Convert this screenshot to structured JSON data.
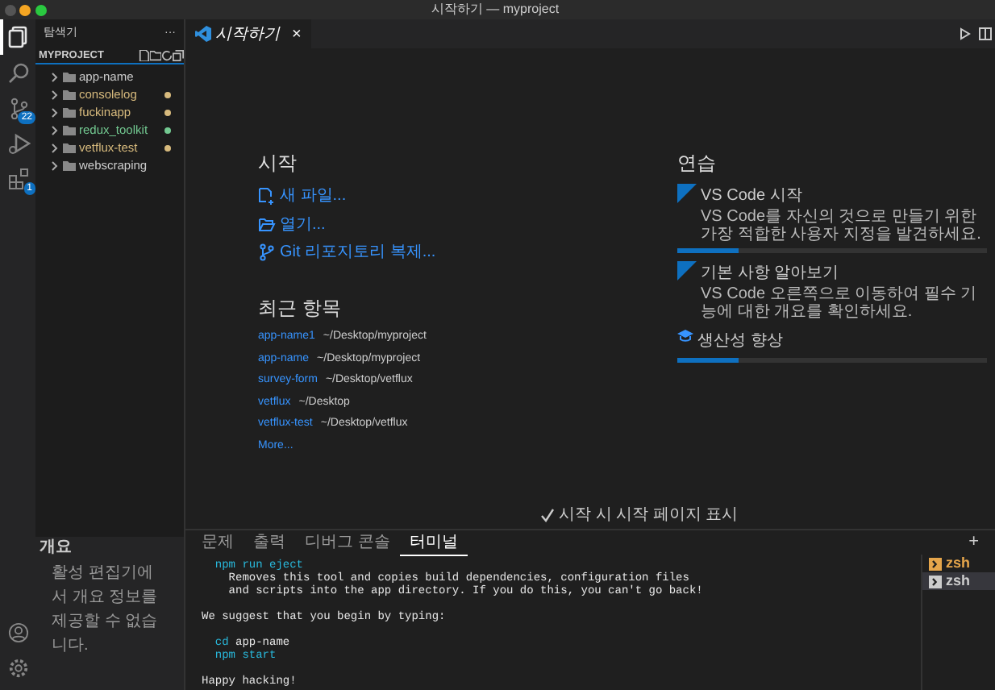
{
  "window": {
    "title": "시작하기 — myproject"
  },
  "activity_bar": {
    "items": [
      {
        "kind": "explorer",
        "selected": true
      },
      {
        "kind": "search",
        "selected": false
      },
      {
        "kind": "source-control",
        "selected": false,
        "badge": "22"
      },
      {
        "kind": "run",
        "selected": false
      },
      {
        "kind": "extensions",
        "selected": false,
        "badge": "1"
      }
    ]
  },
  "sidebar": {
    "title": "탐색기",
    "more": "···",
    "project": "MYPROJECT",
    "folders": [
      {
        "name": "app-name",
        "color": "#cccccc",
        "dot": false
      },
      {
        "name": "consolelog",
        "color": "#d7ba7d",
        "dot": true
      },
      {
        "name": "fuckinapp",
        "color": "#d7ba7d",
        "dot": true
      },
      {
        "name": "redux_toolkit",
        "color": "#73c991",
        "dot": true
      },
      {
        "name": "vetflux-test",
        "color": "#d7ba7d",
        "dot": true
      },
      {
        "name": "webscraping",
        "color": "#cccccc",
        "dot": false
      }
    ],
    "outline": {
      "title": "개요",
      "message": "활성 편집기에서 개요 정보를 제공할 수 없습니다."
    }
  },
  "tabs": [
    {
      "label": "시작하기",
      "selected": true,
      "close": "×"
    }
  ],
  "welcome": {
    "start": {
      "heading": "시작",
      "actions": [
        {
          "kind": "new-file",
          "label": "새 파일..."
        },
        {
          "kind": "open",
          "label": "열기..."
        },
        {
          "kind": "git",
          "label": "Git 리포지토리 복제..."
        }
      ]
    },
    "recent": {
      "heading": "최근 항목",
      "items": [
        {
          "name": "app-name1",
          "path": "~/Desktop/myproject"
        },
        {
          "name": "app-name",
          "path": "~/Desktop/myproject"
        },
        {
          "name": "survey-form",
          "path": "~/Desktop/vetflux"
        },
        {
          "name": "vetflux",
          "path": "~/Desktop"
        },
        {
          "name": "vetflux-test",
          "path": "~/Desktop/vetflux"
        }
      ],
      "more": "More..."
    },
    "walkthroughs": {
      "heading": "연습",
      "items": [
        {
          "kind": "featured",
          "title": "VS Code 시작",
          "description": "VS Code를 자신의 것으로 만들기 위한 가장 적합한 사용자 지정을 발견하세요.",
          "level": 0.2
        },
        {
          "kind": "featured",
          "title": "기본 사항 알아보기",
          "description": "VS Code 오른쪽으로 이동하여 필수 기능에 대한 개요를 확인하세요."
        },
        {
          "kind": "simple",
          "title": "생산성 향상",
          "level": 0.2
        }
      ]
    },
    "show_on_startup": {
      "label": "시작 시 시작 페이지 표시",
      "checked": true
    }
  },
  "panel": {
    "tabs": [
      {
        "label": "문제",
        "selected": false
      },
      {
        "label": "출력",
        "selected": false
      },
      {
        "label": "디버그 콘솔",
        "selected": false
      },
      {
        "label": "터미널",
        "selected": true
      }
    ],
    "add": "+",
    "terminal_lines": [
      {
        "kind": "command",
        "indent": true,
        "command": "npm run eject"
      },
      {
        "kind": "text",
        "text": "    Removes this tool and copies build dependencies, configuration files"
      },
      {
        "kind": "text",
        "text": "    and scripts into the app directory. If you do this, you can't go back!"
      },
      {
        "kind": "blank"
      },
      {
        "kind": "text",
        "text": "We suggest that you begin by typing:"
      },
      {
        "kind": "blank"
      },
      {
        "kind": "command",
        "indent": true,
        "command": "cd",
        "argument": "app-name"
      },
      {
        "kind": "command",
        "indent": true,
        "command": "npm start"
      },
      {
        "kind": "blank"
      },
      {
        "kind": "text",
        "text": "Happy hacking!"
      }
    ],
    "terminals": [
      {
        "label": "zsh",
        "selected": false,
        "color": "#e5a54b"
      },
      {
        "label": "zsh",
        "selected": true,
        "color": "#cccccc"
      }
    ]
  }
}
